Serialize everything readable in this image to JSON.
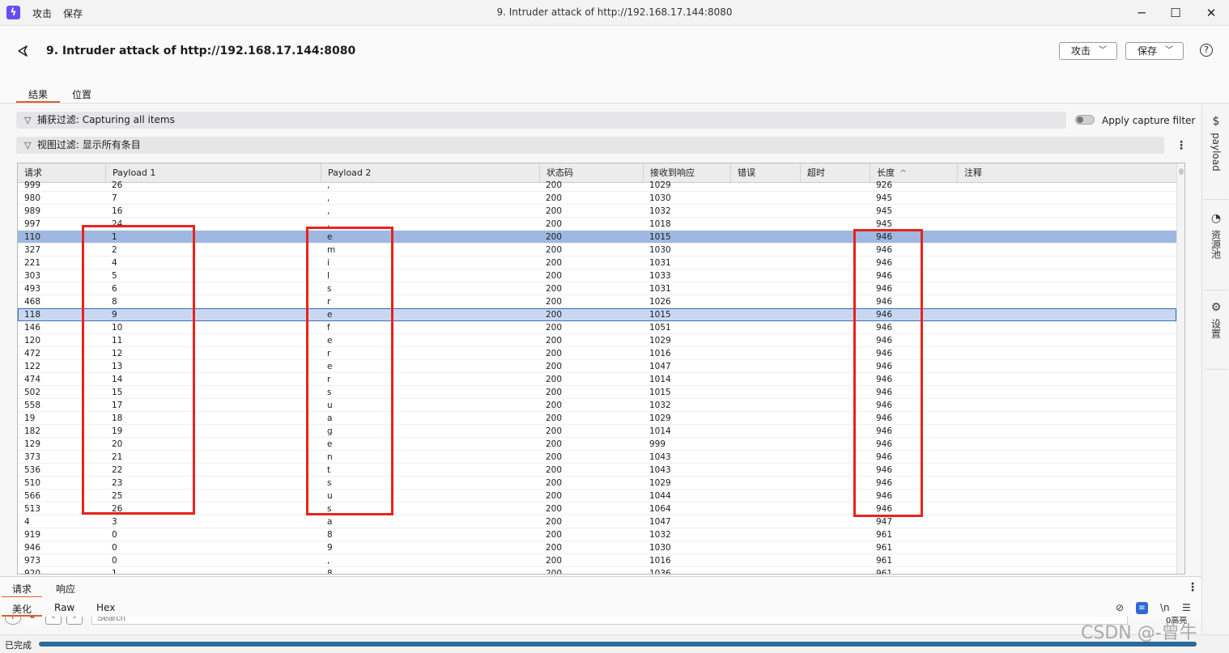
{
  "window": {
    "menu": [
      "攻击",
      "保存"
    ],
    "title": "9. Intruder attack of http://192.168.17.144:8080",
    "controls": [
      "─",
      "☐",
      "✕"
    ]
  },
  "header": {
    "title": "9. Intruder attack of http://192.168.17.144:8080",
    "attack_button": "攻击",
    "save_button": "保存",
    "help": "?",
    "tabs": [
      "结果",
      "位置"
    ]
  },
  "filters": {
    "capture_label": "捕获过滤:",
    "capture_value": "Capturing all items",
    "apply_capture": "Apply capture filter",
    "view_label": "视图过滤:",
    "view_value": "显示所有条目"
  },
  "table": {
    "columns": [
      "请求",
      "Payload 1",
      "Payload 2",
      "状态码",
      "接收到响应",
      "错误",
      "超时",
      "长度",
      "注释"
    ],
    "sort_indicator": "^",
    "rows": [
      [
        "999",
        "26",
        ",",
        "200",
        "1029",
        "",
        "",
        "926",
        ""
      ],
      [
        "980",
        "7",
        ",",
        "200",
        "1030",
        "",
        "",
        "945",
        ""
      ],
      [
        "989",
        "16",
        ",",
        "200",
        "1032",
        "",
        "",
        "945",
        ""
      ],
      [
        "997",
        "24",
        ",",
        "200",
        "1018",
        "",
        "",
        "945",
        ""
      ],
      [
        "110",
        "1",
        "e",
        "200",
        "1015",
        "",
        "",
        "946",
        ""
      ],
      [
        "327",
        "2",
        "m",
        "200",
        "1030",
        "",
        "",
        "946",
        ""
      ],
      [
        "221",
        "4",
        "i",
        "200",
        "1031",
        "",
        "",
        "946",
        ""
      ],
      [
        "303",
        "5",
        "l",
        "200",
        "1033",
        "",
        "",
        "946",
        ""
      ],
      [
        "493",
        "6",
        "s",
        "200",
        "1031",
        "",
        "",
        "946",
        ""
      ],
      [
        "468",
        "8",
        "r",
        "200",
        "1026",
        "",
        "",
        "946",
        ""
      ],
      [
        "118",
        "9",
        "e",
        "200",
        "1015",
        "",
        "",
        "946",
        ""
      ],
      [
        "146",
        "10",
        "f",
        "200",
        "1051",
        "",
        "",
        "946",
        ""
      ],
      [
        "120",
        "11",
        "e",
        "200",
        "1029",
        "",
        "",
        "946",
        ""
      ],
      [
        "472",
        "12",
        "r",
        "200",
        "1016",
        "",
        "",
        "946",
        ""
      ],
      [
        "122",
        "13",
        "e",
        "200",
        "1047",
        "",
        "",
        "946",
        ""
      ],
      [
        "474",
        "14",
        "r",
        "200",
        "1014",
        "",
        "",
        "946",
        ""
      ],
      [
        "502",
        "15",
        "s",
        "200",
        "1015",
        "",
        "",
        "946",
        ""
      ],
      [
        "558",
        "17",
        "u",
        "200",
        "1032",
        "",
        "",
        "946",
        ""
      ],
      [
        "19",
        "18",
        "a",
        "200",
        "1029",
        "",
        "",
        "946",
        ""
      ],
      [
        "182",
        "19",
        "g",
        "200",
        "1014",
        "",
        "",
        "946",
        ""
      ],
      [
        "129",
        "20",
        "e",
        "200",
        "999",
        "",
        "",
        "946",
        ""
      ],
      [
        "373",
        "21",
        "n",
        "200",
        "1043",
        "",
        "",
        "946",
        ""
      ],
      [
        "536",
        "22",
        "t",
        "200",
        "1043",
        "",
        "",
        "946",
        ""
      ],
      [
        "510",
        "23",
        "s",
        "200",
        "1029",
        "",
        "",
        "946",
        ""
      ],
      [
        "566",
        "25",
        "u",
        "200",
        "1044",
        "",
        "",
        "946",
        ""
      ],
      [
        "513",
        "26",
        "s",
        "200",
        "1064",
        "",
        "",
        "946",
        ""
      ],
      [
        "4",
        "3",
        "a",
        "200",
        "1047",
        "",
        "",
        "947",
        ""
      ],
      [
        "919",
        "0",
        "8",
        "200",
        "1032",
        "",
        "",
        "961",
        ""
      ],
      [
        "946",
        "0",
        "9",
        "200",
        "1030",
        "",
        "",
        "961",
        ""
      ],
      [
        "973",
        "0",
        ",",
        "200",
        "1016",
        "",
        "",
        "961",
        ""
      ],
      [
        "920",
        "1",
        "8",
        "200",
        "1036",
        "",
        "",
        "961",
        ""
      ]
    ],
    "selected_row_index": 4,
    "focused_row_index": 10
  },
  "sidebar": {
    "items": [
      "payload",
      "资源池",
      "设置"
    ]
  },
  "bottom": {
    "tabs": [
      "请求",
      "响应"
    ],
    "subtabs": [
      "美化",
      "Raw",
      "Hex"
    ],
    "search_placeholder": "Search",
    "highlights_partial": "0高亮"
  },
  "status": {
    "text": "已完成",
    "progress": 1.0
  },
  "watermark": "CSDN @-曾牛",
  "colors": {
    "accent": "#e55b2b",
    "selection": "#9eb8e2",
    "annotation": "#e8231b",
    "progress": "#2c6a9a"
  }
}
